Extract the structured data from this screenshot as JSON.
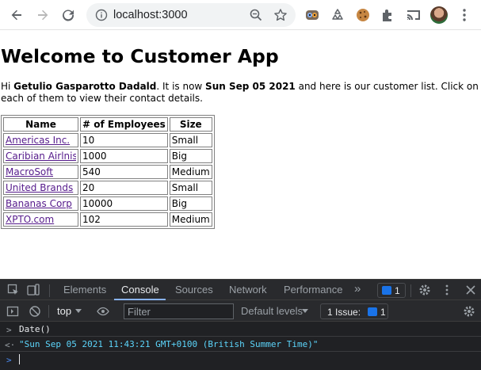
{
  "browser": {
    "url": "localhost:3000"
  },
  "page": {
    "title": "Welcome to Customer App",
    "intro": {
      "greeting": "Hi ",
      "user_name": "Getulio Gasparotto Dadald",
      "mid": ". It is now ",
      "date": "Sun Sep 05 2021",
      "tail": " and here is our customer list. Click on each of them to view their contact details."
    },
    "table": {
      "headers": [
        "Name",
        "# of Employees",
        "Size"
      ],
      "rows": [
        {
          "name": "Americas Inc.",
          "employees": "10",
          "size": "Small"
        },
        {
          "name": "Caribian Airlnis",
          "employees": "1000",
          "size": "Big"
        },
        {
          "name": "MacroSoft",
          "employees": "540",
          "size": "Medium"
        },
        {
          "name": "United Brands",
          "employees": "20",
          "size": "Small"
        },
        {
          "name": "Bananas Corp",
          "employees": "10000",
          "size": "Big"
        },
        {
          "name": "XPTO.com",
          "employees": "102",
          "size": "Medium"
        }
      ]
    }
  },
  "devtools": {
    "tabs": [
      "Elements",
      "Console",
      "Sources",
      "Network",
      "Performance"
    ],
    "active_tab": "Console",
    "more_tabs": "»",
    "message_count": "1",
    "context": "top",
    "filter_placeholder": "Filter",
    "levels": "Default levels",
    "issues_label": "1 Issue:",
    "issues_count": "1",
    "console": [
      {
        "prefix": ">",
        "text": "Date()",
        "kind": "input"
      },
      {
        "prefix": "<·",
        "text": "\"Sun Sep 05 2021 11:43:21 GMT+0100 (British Summer Time)\"",
        "kind": "result"
      }
    ],
    "prompt": ">"
  },
  "colors": {
    "link": "#551a8b",
    "devtools_bg": "#202124",
    "string_result": "#5cd5fb",
    "accent_blue": "#1a73e8"
  }
}
